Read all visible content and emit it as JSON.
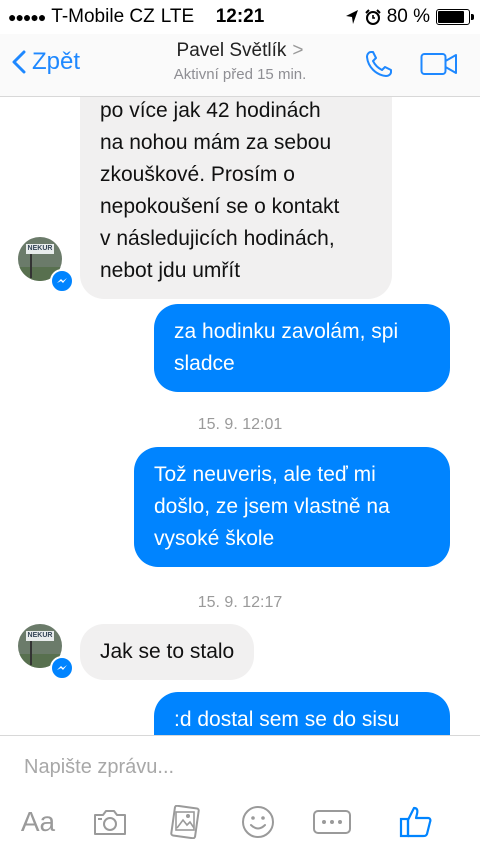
{
  "status_bar": {
    "signal_dots": "●●●●●",
    "carrier": "T-Mobile CZ",
    "network": "LTE",
    "time": "12:21",
    "battery_text": "80 %",
    "battery_level": 0.8
  },
  "header": {
    "back_label": "Zpět",
    "contact_name": "Pavel Světlík",
    "chevron": ">",
    "presence": "Aktivní před 15 min.",
    "accent": "#1e88ff"
  },
  "conversation": {
    "incoming_1_lines": [
      "po více jak 42 hodinách",
      "na nohou mám za sebou",
      "zkouškové. Prosím o",
      "nepokoušení se o kontakt",
      "v následujicích hodinách,",
      "nebot jdu umřít"
    ],
    "outgoing_1_lines": [
      "za hodinku zavolám, spi",
      "sladce"
    ],
    "timestamp_1": "15. 9. 12:01",
    "outgoing_2_lines": [
      "Tož neuveris, ale teď mi",
      "došlo, ze jsem vlastně na",
      "vysoké škole"
    ],
    "timestamp_2": "15. 9. 12:17",
    "incoming_2": "Jak se to stalo",
    "outgoing_3": ":d dostal sem se do sisu",
    "avatar_sign_text": "NEKUR",
    "colors": {
      "outgoing_bubble": "#0084ff",
      "incoming_bubble": "#f1f0f0"
    }
  },
  "composer": {
    "placeholder": "Napište zprávu...",
    "aa_label": "Aa",
    "icons": [
      "camera-icon",
      "gallery-icon",
      "emoji-icon",
      "more-icon",
      "like-icon"
    ]
  }
}
